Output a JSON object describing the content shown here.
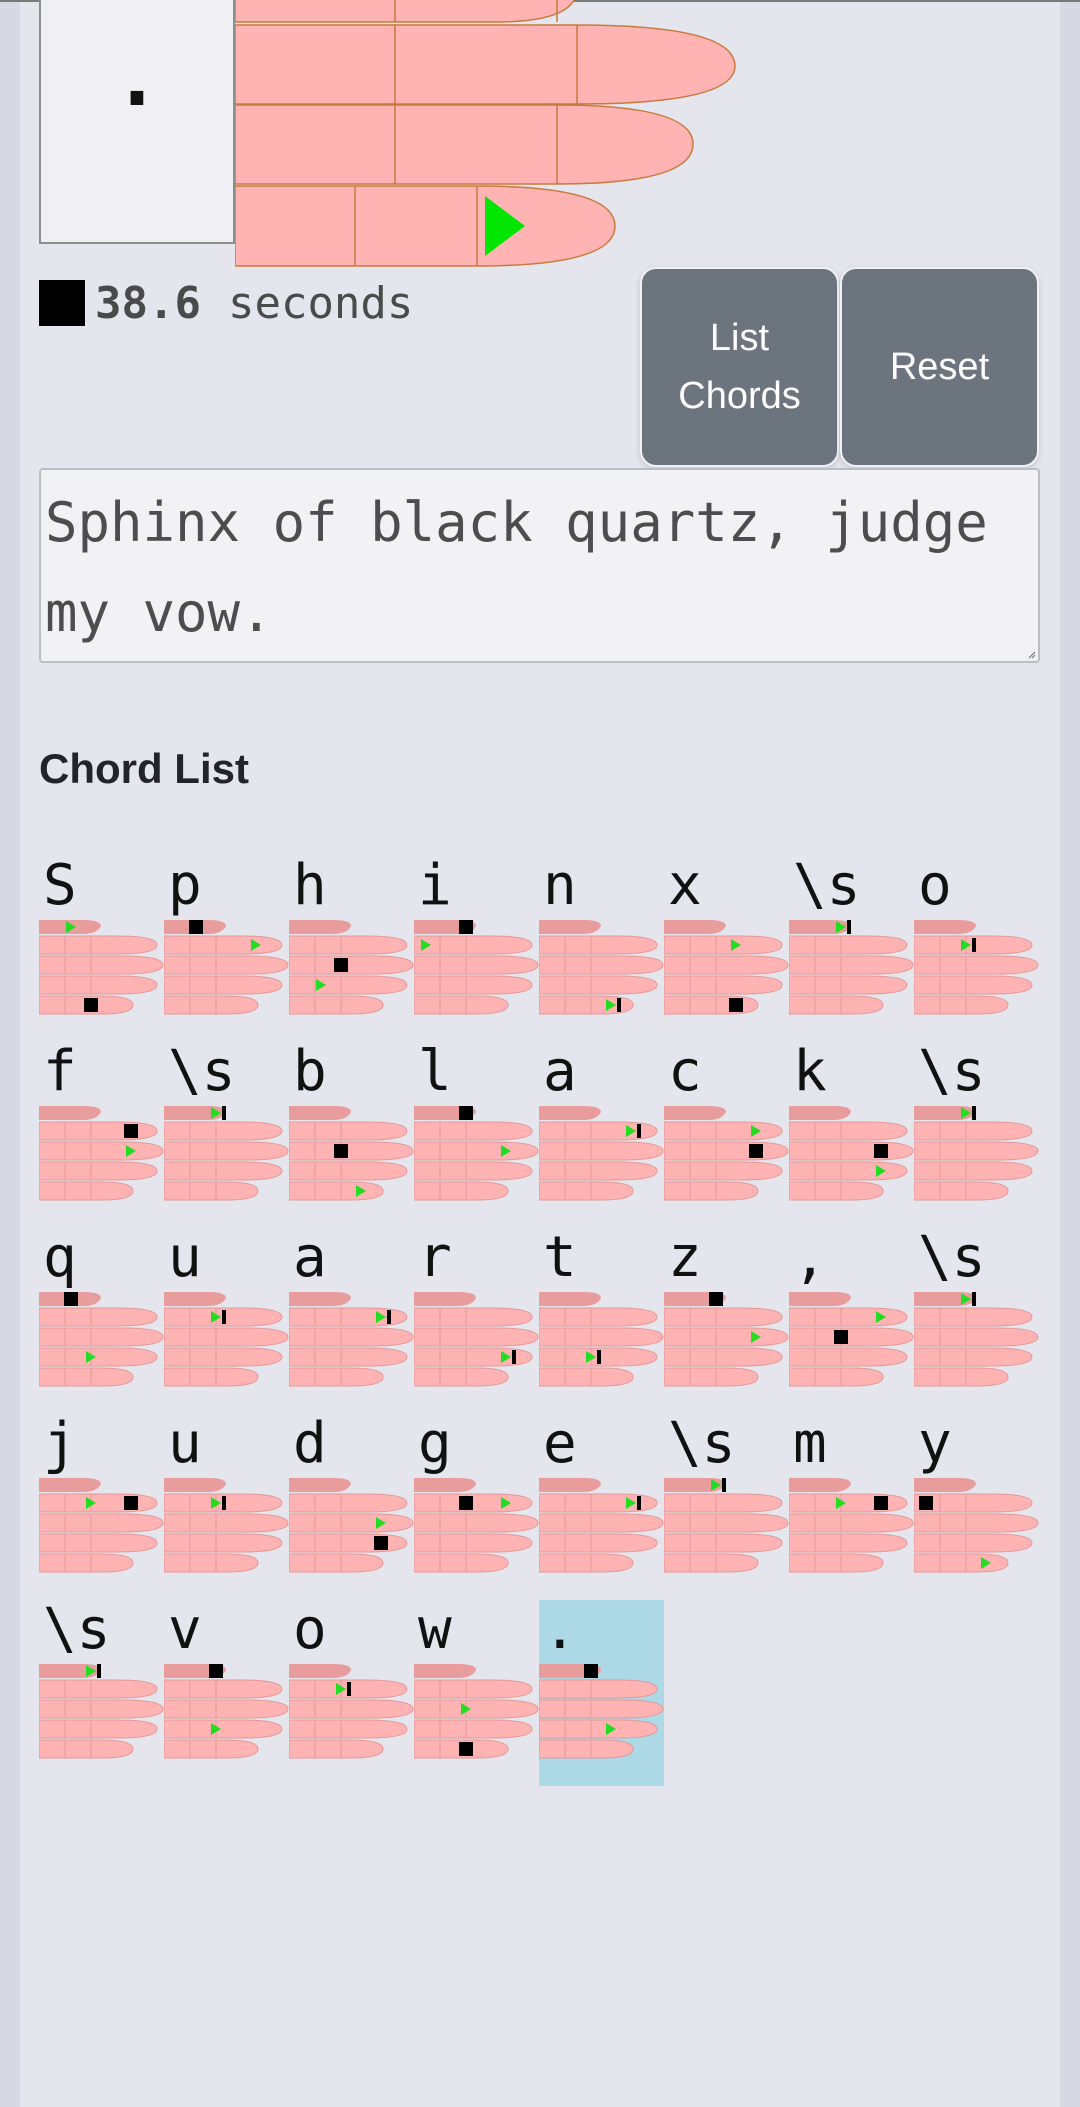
{
  "current": {
    "character": "."
  },
  "timer": {
    "value": "38.6",
    "unit": "seconds"
  },
  "buttons": {
    "list_chords": "List Chords",
    "reset": "Reset"
  },
  "text_input": {
    "value": "Sphinx of black quartz, judge my vow."
  },
  "chord_list": {
    "title": "Chord List",
    "selected_index": 36,
    "chords": [
      {
        "char": "S",
        "marks": [
          [
            "t",
            "a",
            2
          ],
          [
            "p",
            "s",
            3
          ]
        ]
      },
      {
        "char": "p",
        "marks": [
          [
            "t",
            "s",
            2
          ],
          [
            "i",
            "a",
            5
          ]
        ]
      },
      {
        "char": "h",
        "marks": [
          [
            "m",
            "s",
            3
          ],
          [
            "r",
            "a",
            2
          ]
        ]
      },
      {
        "char": "i",
        "marks": [
          [
            "t",
            "s",
            3
          ],
          [
            "i",
            "a",
            1
          ]
        ]
      },
      {
        "char": "n",
        "marks": [
          [
            "p",
            "a",
            4
          ],
          [
            "p",
            "b",
            4
          ]
        ]
      },
      {
        "char": "x",
        "marks": [
          [
            "i",
            "a",
            4
          ],
          [
            "p",
            "s",
            4
          ]
        ]
      },
      {
        "char": "\\s",
        "marks": [
          [
            "t",
            "a",
            3
          ],
          [
            "t",
            "b",
            3
          ]
        ]
      },
      {
        "char": "o",
        "marks": [
          [
            "i",
            "a",
            3
          ],
          [
            "i",
            "b",
            3
          ]
        ]
      },
      {
        "char": "f",
        "marks": [
          [
            "i",
            "s",
            5
          ],
          [
            "m",
            "a",
            5
          ]
        ]
      },
      {
        "char": "\\s",
        "marks": [
          [
            "t",
            "a",
            3
          ],
          [
            "t",
            "b",
            3
          ]
        ]
      },
      {
        "char": "b",
        "marks": [
          [
            "m",
            "s",
            3
          ],
          [
            "p",
            "a",
            4
          ]
        ]
      },
      {
        "char": "l",
        "marks": [
          [
            "t",
            "s",
            3
          ],
          [
            "m",
            "a",
            5
          ]
        ]
      },
      {
        "char": "a",
        "marks": [
          [
            "i",
            "a",
            5
          ],
          [
            "i",
            "b",
            5
          ]
        ]
      },
      {
        "char": "c",
        "marks": [
          [
            "i",
            "a",
            5
          ],
          [
            "m",
            "s",
            5
          ]
        ]
      },
      {
        "char": "k",
        "marks": [
          [
            "m",
            "s",
            5
          ],
          [
            "r",
            "a",
            5
          ]
        ]
      },
      {
        "char": "\\s",
        "marks": [
          [
            "t",
            "a",
            3
          ],
          [
            "t",
            "b",
            3
          ]
        ]
      },
      {
        "char": "q",
        "marks": [
          [
            "t",
            "s",
            2
          ],
          [
            "r",
            "a",
            3
          ]
        ]
      },
      {
        "char": "u",
        "marks": [
          [
            "i",
            "a",
            3
          ],
          [
            "i",
            "b",
            3
          ]
        ]
      },
      {
        "char": "a",
        "marks": [
          [
            "i",
            "a",
            5
          ],
          [
            "i",
            "b",
            5
          ]
        ]
      },
      {
        "char": "r",
        "marks": [
          [
            "r",
            "a",
            5
          ],
          [
            "r",
            "b",
            5
          ]
        ]
      },
      {
        "char": "t",
        "marks": [
          [
            "r",
            "a",
            3
          ],
          [
            "r",
            "b",
            3
          ]
        ]
      },
      {
        "char": "z",
        "marks": [
          [
            "t",
            "s",
            3
          ],
          [
            "m",
            "a",
            5
          ]
        ]
      },
      {
        "char": ",",
        "marks": [
          [
            "i",
            "a",
            5
          ],
          [
            "m",
            "s",
            3
          ]
        ]
      },
      {
        "char": "\\s",
        "marks": [
          [
            "t",
            "a",
            3
          ],
          [
            "t",
            "b",
            3
          ]
        ]
      },
      {
        "char": "j",
        "marks": [
          [
            "i",
            "a",
            3
          ],
          [
            "i",
            "s",
            5
          ]
        ]
      },
      {
        "char": "u",
        "marks": [
          [
            "i",
            "a",
            3
          ],
          [
            "i",
            "b",
            3
          ]
        ]
      },
      {
        "char": "d",
        "marks": [
          [
            "m",
            "a",
            5
          ],
          [
            "r",
            "s",
            5
          ]
        ]
      },
      {
        "char": "g",
        "marks": [
          [
            "i",
            "s",
            3
          ],
          [
            "i",
            "a",
            5
          ]
        ]
      },
      {
        "char": "e",
        "marks": [
          [
            "i",
            "a",
            5
          ],
          [
            "i",
            "b",
            5
          ]
        ]
      },
      {
        "char": "\\s",
        "marks": [
          [
            "t",
            "a",
            3
          ],
          [
            "t",
            "b",
            3
          ]
        ]
      },
      {
        "char": "m",
        "marks": [
          [
            "i",
            "a",
            3
          ],
          [
            "i",
            "s",
            5
          ]
        ]
      },
      {
        "char": "y",
        "marks": [
          [
            "i",
            "s",
            1
          ],
          [
            "p",
            "a",
            4
          ]
        ]
      },
      {
        "char": "\\s",
        "marks": [
          [
            "t",
            "a",
            3
          ],
          [
            "t",
            "b",
            3
          ]
        ]
      },
      {
        "char": "v",
        "marks": [
          [
            "t",
            "s",
            3
          ],
          [
            "r",
            "a",
            3
          ]
        ]
      },
      {
        "char": "o",
        "marks": [
          [
            "i",
            "a",
            3
          ],
          [
            "i",
            "b",
            3
          ]
        ]
      },
      {
        "char": "w",
        "marks": [
          [
            "m",
            "a",
            3
          ],
          [
            "p",
            "s",
            3
          ]
        ]
      },
      {
        "char": ".",
        "marks": [
          [
            "t",
            "s",
            3
          ],
          [
            "r",
            "a",
            4
          ]
        ]
      }
    ]
  }
}
